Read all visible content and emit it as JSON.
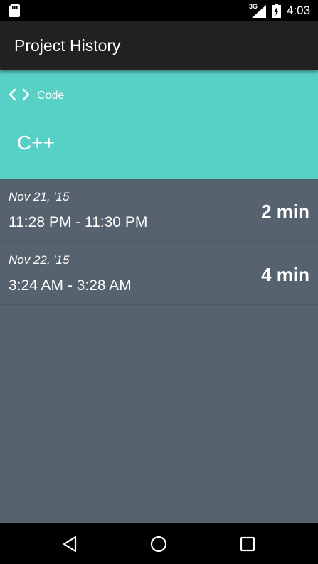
{
  "status_bar": {
    "network_label": "3G",
    "time": "4:03",
    "icons": [
      "sd-card-icon",
      "signal-icon",
      "battery-icon"
    ]
  },
  "app_bar": {
    "title": "Project History"
  },
  "project": {
    "category_icon": "code-icon",
    "category": "Code",
    "name": "C++",
    "color": "#57d0c5"
  },
  "sessions": [
    {
      "date": "Nov 21, '15",
      "time_range": "11:28 PM - 11:30 PM",
      "duration": "2 min"
    },
    {
      "date": "Nov 22, '15",
      "time_range": "3:24 AM - 3:28 AM",
      "duration": "4 min"
    }
  ],
  "nav_bar": {
    "icons": [
      "back-icon",
      "home-icon",
      "recents-icon"
    ]
  },
  "colors": {
    "background": "#56636f",
    "app_bar": "#212121",
    "accent": "#57d0c5"
  }
}
